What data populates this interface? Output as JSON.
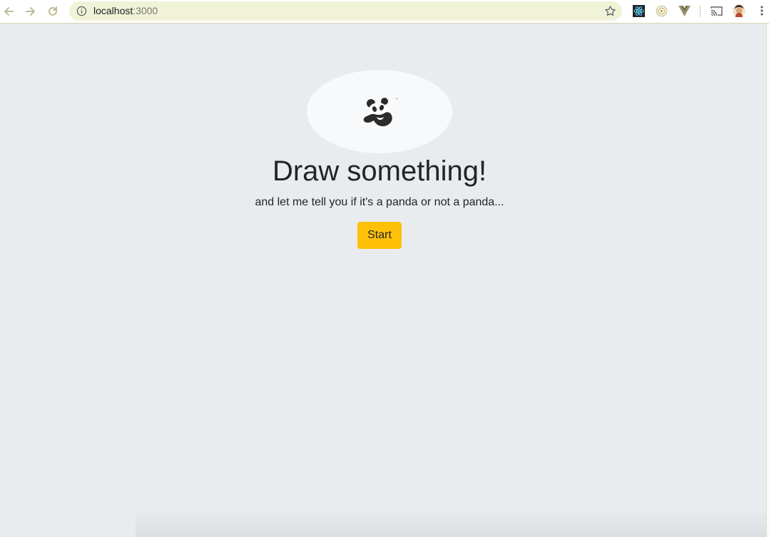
{
  "browser": {
    "url_host": "localhost",
    "url_port": ":3000",
    "icons": {
      "back": "back-arrow-icon",
      "forward": "forward-arrow-icon",
      "reload": "reload-icon",
      "info": "info-icon",
      "bookmark": "star-icon",
      "ext1": "react-devtools-icon",
      "ext2": "extension-icon",
      "ext3": "vue-devtools-icon",
      "cast": "cast-icon",
      "profile": "avatar",
      "menu": "kebab-menu-icon"
    }
  },
  "page": {
    "title": "Draw something!",
    "subtitle": "and let me tell you if it's a panda or not a panda...",
    "start_label": "Start"
  },
  "colors": {
    "background": "#e9ecef",
    "button": "#ffc107",
    "logo_bg": "#f8f9fa",
    "text": "#212529"
  }
}
